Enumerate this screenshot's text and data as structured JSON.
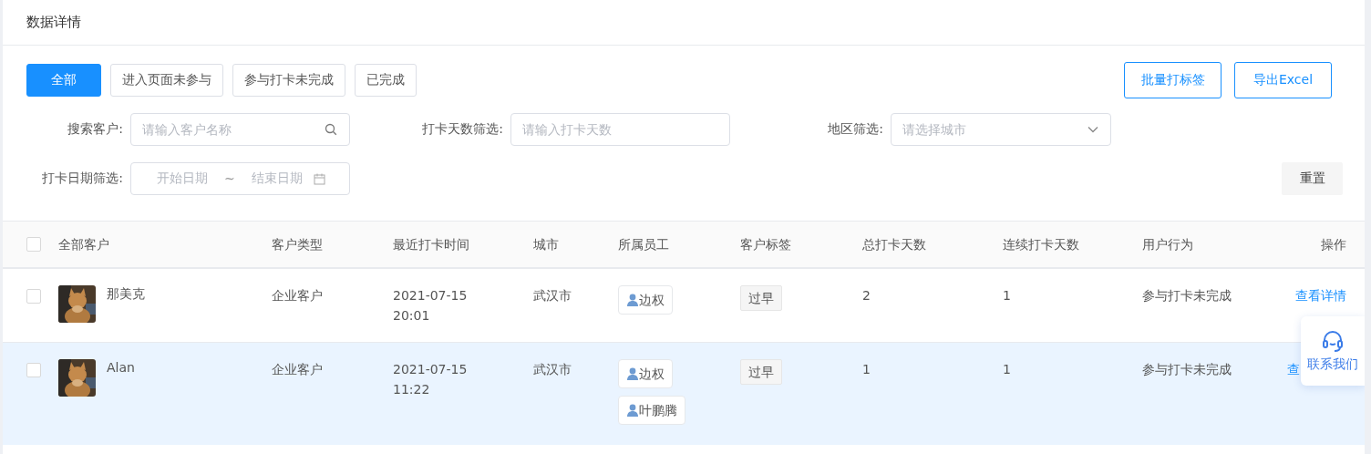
{
  "page": {
    "title": "数据详情"
  },
  "filter_tabs": [
    {
      "label": "全部",
      "selected": true
    },
    {
      "label": "进入页面未参与",
      "selected": false
    },
    {
      "label": "参与打卡未完成",
      "selected": false
    },
    {
      "label": "已完成",
      "selected": false
    }
  ],
  "actions": [
    "批量打标签",
    "导出Excel"
  ],
  "filters": {
    "search": {
      "label": "搜索客户:",
      "placeholder": "请输入客户名称"
    },
    "days": {
      "label": "打卡天数筛选:",
      "placeholder": "请输入打卡天数"
    },
    "region": {
      "label": "地区筛选:",
      "placeholder": "请选择城市"
    },
    "date": {
      "label": "打卡日期筛选:",
      "start_placeholder": "开始日期",
      "separator": "~",
      "end_placeholder": "结束日期"
    },
    "reset": "重置"
  },
  "table": {
    "all_checked": false,
    "columns": [
      "全部客户",
      "客户类型",
      "最近打卡时间",
      "城市",
      "所属员工",
      "客户标签",
      "总打卡天数",
      "连续打卡天数",
      "用户行为",
      "操作"
    ],
    "rows": [
      {
        "checked": false,
        "highlighted": false,
        "avatar": {
          "kind": "picture"
        },
        "name": "那美克",
        "type": "企业客户",
        "date": "2021-07-15",
        "time": "20:01",
        "city": "武汉市",
        "staff": [
          "边权"
        ],
        "tags": [
          "过早"
        ],
        "total_days": "2",
        "streak_days": "1",
        "behavior": "参与打卡未完成",
        "action": "查看详情"
      },
      {
        "checked": false,
        "highlighted": true,
        "avatar": {
          "kind": "picture"
        },
        "name": "Alan",
        "type": "企业客户",
        "date": "2021-07-15",
        "time": "11:22",
        "city": "武汉市",
        "staff": [
          "边权",
          "叶鹏腾"
        ],
        "tags": [
          "过早"
        ],
        "total_days": "1",
        "streak_days": "1",
        "behavior": "参与打卡未完成",
        "action": "查"
      }
    ]
  },
  "contact_widget": {
    "label": "联系我们"
  }
}
